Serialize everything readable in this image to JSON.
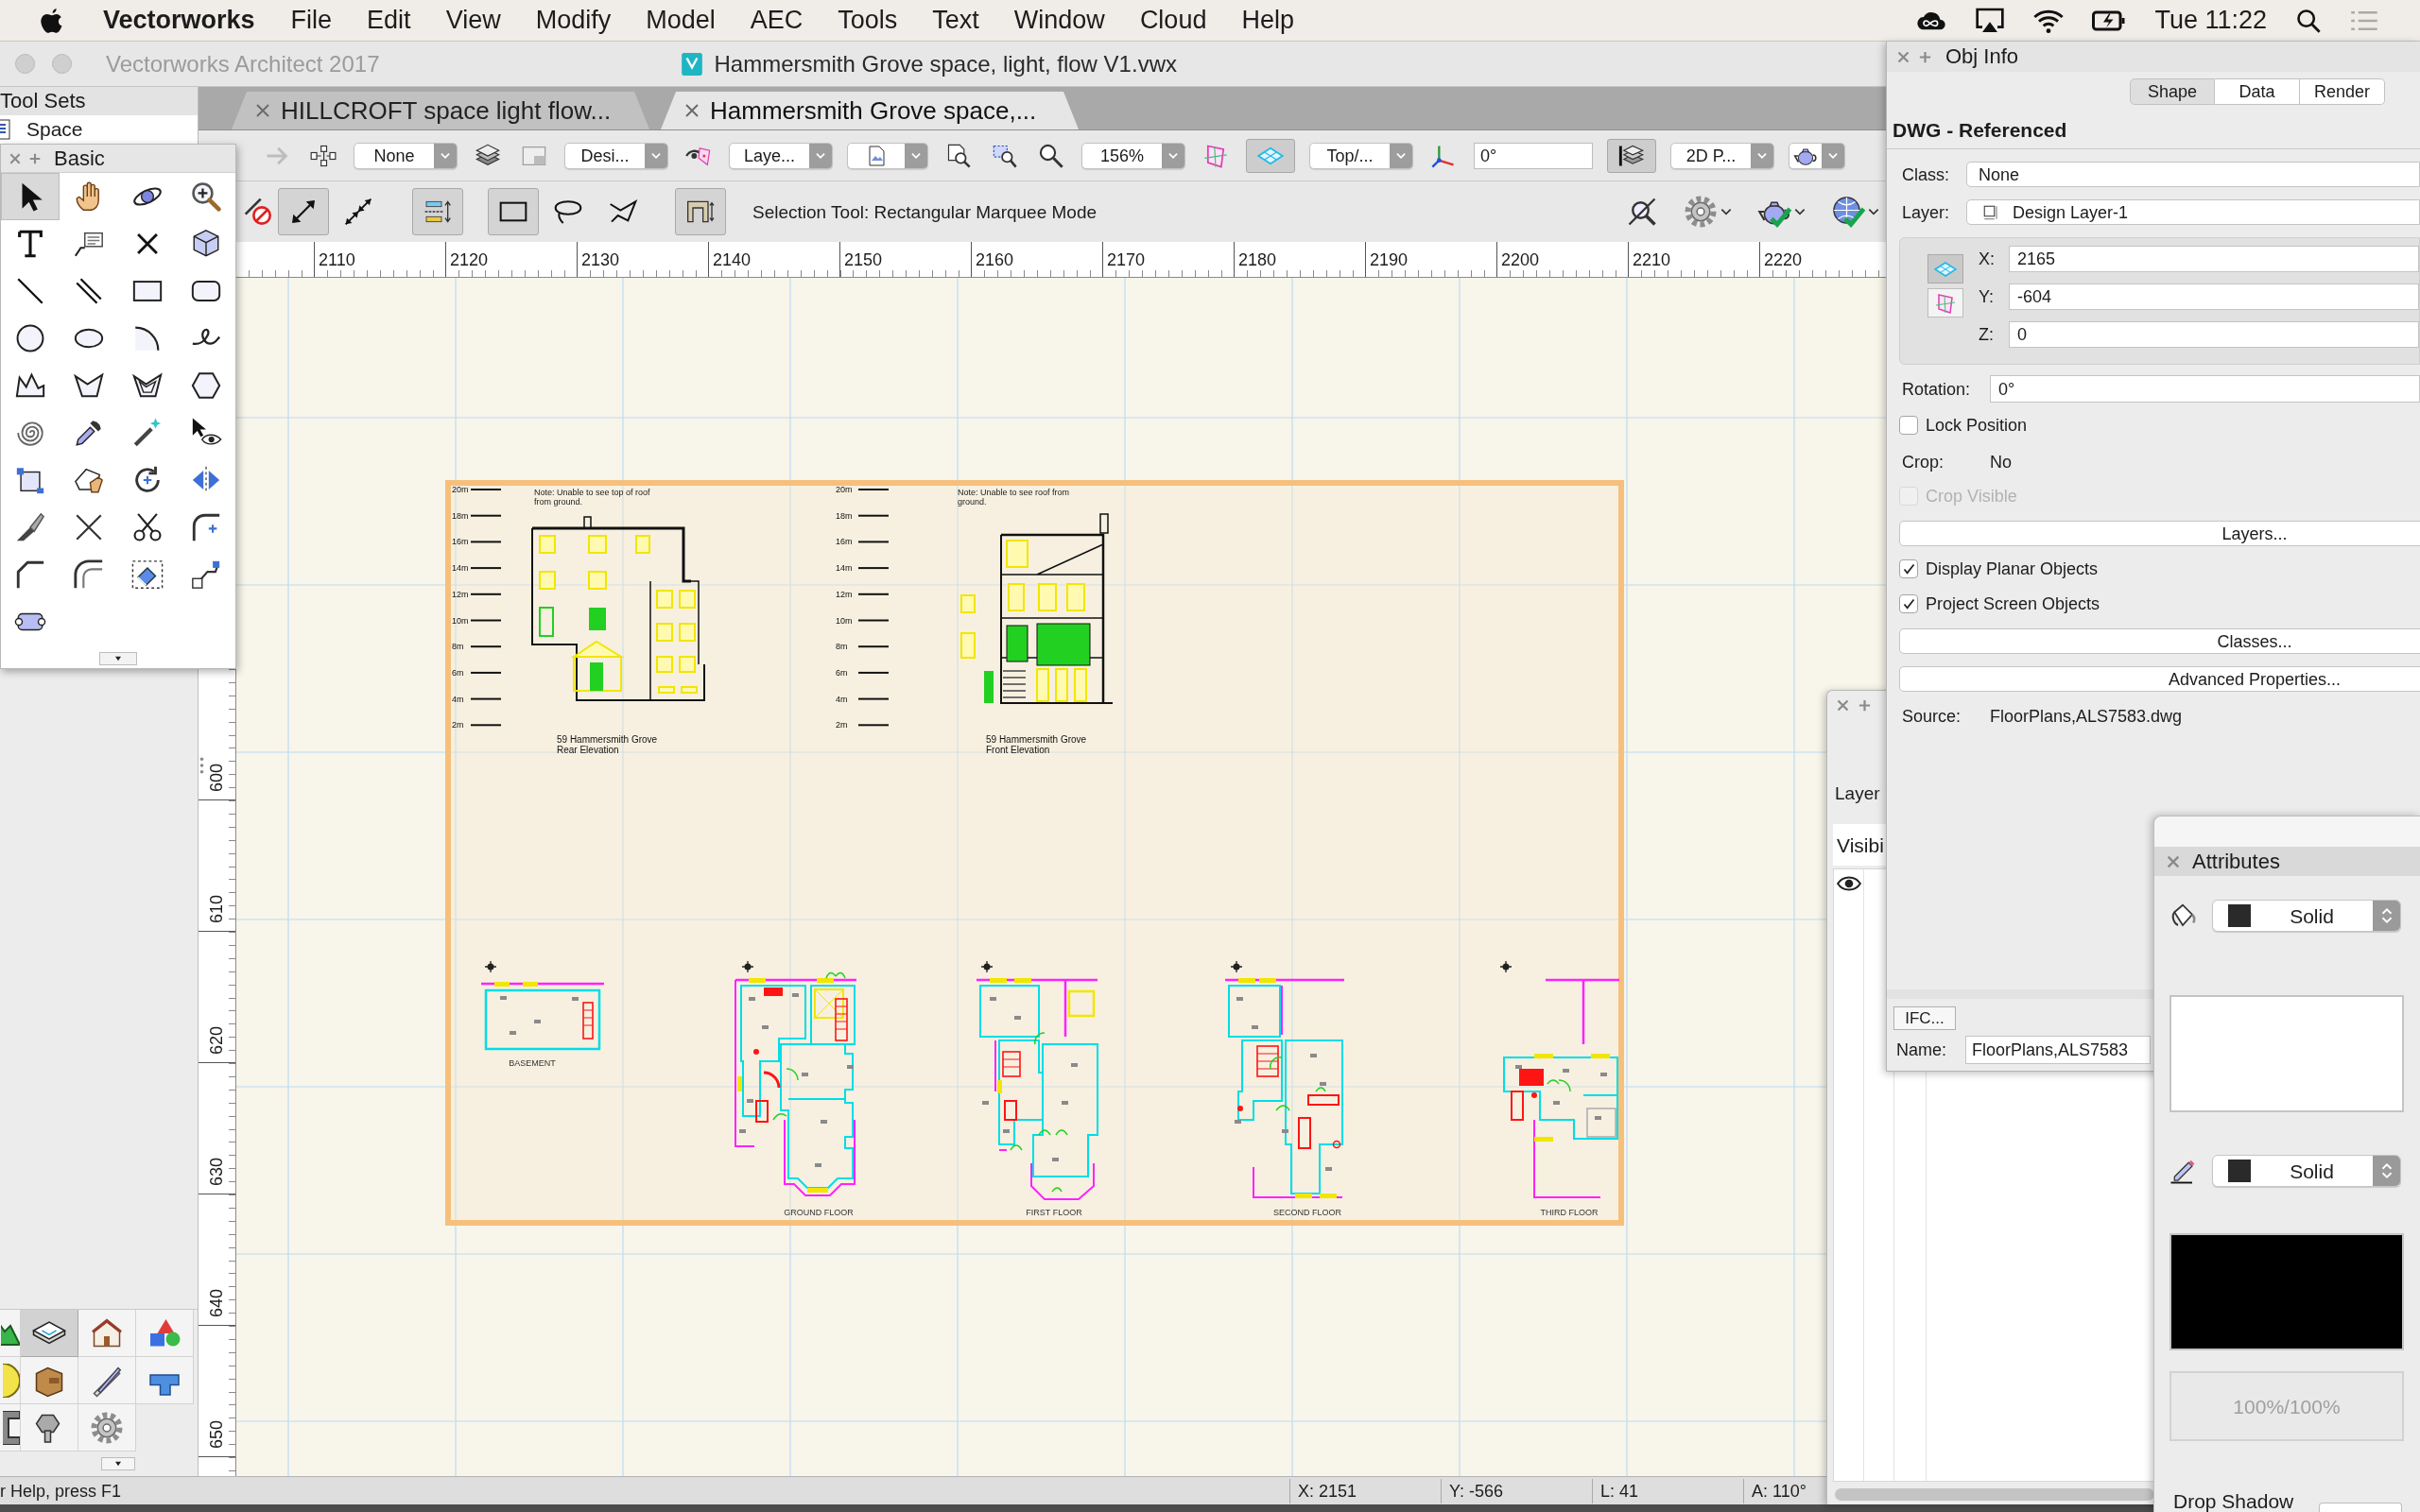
{
  "menu_bar": {
    "app_name": "Vectorworks",
    "menus": [
      "File",
      "Edit",
      "View",
      "Modify",
      "Model",
      "AEC",
      "Tools",
      "Text",
      "Window",
      "Cloud",
      "Help"
    ],
    "clock": "Tue 11:22"
  },
  "window": {
    "app_title": "Vectorworks Architect 2017",
    "document_title": "Hammersmith Grove space, light, flow V1.vwx"
  },
  "tool_sets": {
    "title": "Tool Sets",
    "current": "Space",
    "sets": [
      {
        "kind": "site",
        "selected": false
      },
      {
        "kind": "slab",
        "selected": true
      },
      {
        "kind": "house",
        "selected": false
      },
      {
        "kind": "shapes",
        "selected": false
      },
      {
        "kind": "light",
        "selected": false
      },
      {
        "kind": "cabinet",
        "selected": false
      },
      {
        "kind": "drafting",
        "selected": false
      },
      {
        "kind": "pipe",
        "selected": false
      },
      {
        "kind": "beam",
        "selected": false
      },
      {
        "kind": "bolt",
        "selected": false
      },
      {
        "kind": "gear",
        "selected": false
      }
    ]
  },
  "basic_palette": {
    "title": "Basic",
    "tools": [
      {
        "kind": "selection",
        "selected": true
      },
      {
        "kind": "pan",
        "selected": false
      },
      {
        "kind": "flyover",
        "selected": false
      },
      {
        "kind": "zoom",
        "selected": false
      },
      {
        "kind": "text",
        "selected": false
      },
      {
        "kind": "callout",
        "selected": false
      },
      {
        "kind": "locus",
        "selected": false
      },
      {
        "kind": "pushpull",
        "selected": false
      },
      {
        "kind": "line",
        "selected": false
      },
      {
        "kind": "double_line",
        "selected": false
      },
      {
        "kind": "rectangle",
        "selected": false
      },
      {
        "kind": "rounded_rectangle",
        "selected": false
      },
      {
        "kind": "circle",
        "selected": false
      },
      {
        "kind": "oval",
        "selected": false
      },
      {
        "kind": "arc",
        "selected": false
      },
      {
        "kind": "freehand",
        "selected": false
      },
      {
        "kind": "polyline",
        "selected": false
      },
      {
        "kind": "polygon",
        "selected": false
      },
      {
        "kind": "double_polygon",
        "selected": false
      },
      {
        "kind": "regular_polygon",
        "selected": false
      },
      {
        "kind": "spiral",
        "selected": false
      },
      {
        "kind": "eyedropper",
        "selected": false
      },
      {
        "kind": "wand",
        "selected": false
      },
      {
        "kind": "visibility",
        "selected": false
      },
      {
        "kind": "reshape",
        "selected": false
      },
      {
        "kind": "attribute_mapping",
        "selected": false
      },
      {
        "kind": "rotate",
        "selected": false
      },
      {
        "kind": "mirror",
        "selected": false
      },
      {
        "kind": "split",
        "selected": false
      },
      {
        "kind": "connect",
        "selected": false
      },
      {
        "kind": "trim",
        "selected": false
      },
      {
        "kind": "fillet",
        "selected": false
      },
      {
        "kind": "chamfer",
        "selected": false
      },
      {
        "kind": "offset",
        "selected": false
      },
      {
        "kind": "eraser",
        "selected": false
      },
      {
        "kind": "clip",
        "selected": false
      },
      {
        "kind": "symbol",
        "selected": false
      }
    ]
  },
  "tabs": [
    {
      "label": "HILLCROFT space light flow...",
      "selected": false
    },
    {
      "label": "Hammersmith Grove space,...",
      "selected": true
    }
  ],
  "view_bar": [
    {
      "kind": "forward",
      "selected": false
    },
    {
      "kind": "classes",
      "selected": false
    },
    {
      "kind": "dropdown",
      "value": "None"
    },
    {
      "kind": "layers",
      "selected": false
    },
    {
      "kind": "layer_mode",
      "selected": false
    },
    {
      "kind": "dropdown",
      "value": "Desi..."
    },
    {
      "kind": "class_visibility",
      "selected": false
    },
    {
      "kind": "dropdown",
      "value": "Laye..."
    },
    {
      "kind": "page_menu"
    },
    {
      "kind": "fit_page",
      "selected": false
    },
    {
      "kind": "fit_objects",
      "selected": false
    },
    {
      "kind": "magnifier",
      "selected": false
    },
    {
      "kind": "dropdown",
      "value": "156%"
    },
    {
      "kind": "working_plane",
      "selected": false
    },
    {
      "kind": "screen_plane",
      "selected": true
    },
    {
      "kind": "dropdown",
      "value": "Top/..."
    },
    {
      "kind": "axes",
      "selected": false
    },
    {
      "kind": "field",
      "value": "0°"
    },
    {
      "kind": "stack_layers",
      "selected": true
    },
    {
      "kind": "dropdown",
      "value": "2D P..."
    },
    {
      "kind": "render_menu"
    }
  ],
  "mode_bar": {
    "modes": [
      {
        "kind": "snap_off",
        "selected": false
      },
      {
        "kind": "snap_single",
        "selected": true
      },
      {
        "kind": "snap_multi",
        "selected": false
      },
      {
        "kind": "align",
        "selected": true
      },
      {
        "kind": "marquee_rect",
        "selected": true
      },
      {
        "kind": "marquee_lasso",
        "selected": false
      },
      {
        "kind": "marquee_polygon",
        "selected": false
      },
      {
        "kind": "frame",
        "selected": true
      }
    ],
    "message": "Selection Tool: Rectangular Marquee Mode",
    "tools": [
      {
        "kind": "no_zoom"
      },
      {
        "kind": "gear_menu"
      },
      {
        "kind": "render_check_menu"
      },
      {
        "kind": "globe_check_menu"
      }
    ]
  },
  "rulers": {
    "horizontal": [
      "2110",
      "2120",
      "2130",
      "2140",
      "2150",
      "2160",
      "2170",
      "2180",
      "2190",
      "2200",
      "2210",
      "2220"
    ],
    "vertical": [
      "600",
      "610",
      "620",
      "630",
      "640",
      "650"
    ]
  },
  "drawing": {
    "elevations": [
      {
        "kind": "rear",
        "note": [
          "Note: Unable to see top of roof",
          "from ground."
        ],
        "scale": [
          "20m",
          "18m",
          "16m",
          "14m",
          "12m",
          "10m",
          "8m",
          "6m",
          "4m",
          "2m"
        ],
        "title": "59 Hammersmith Grove",
        "caption": "Rear Elevation"
      },
      {
        "kind": "front",
        "note": [
          "Note: Unable to see roof from",
          "ground."
        ],
        "scale": [
          "20m",
          "18m",
          "16m",
          "14m",
          "12m",
          "10m",
          "8m",
          "6m",
          "4m",
          "2m"
        ],
        "title": "59 Hammersmith Grove",
        "caption": "Front Elevation"
      }
    ],
    "floor_plans": [
      {
        "kind": "basement",
        "label": "BASEMENT"
      },
      {
        "kind": "ground",
        "label": "GROUND FLOOR"
      },
      {
        "kind": "first",
        "label": "FIRST FLOOR"
      },
      {
        "kind": "second",
        "label": "SECOND FLOOR"
      },
      {
        "kind": "third",
        "label": "THIRD FLOOR"
      }
    ]
  },
  "obj_info": {
    "title": "Obj Info",
    "tabs": [
      {
        "label": "Shape",
        "selected": true
      },
      {
        "label": "Data",
        "selected": false
      },
      {
        "label": "Render",
        "selected": false
      }
    ],
    "object_type": "DWG - Referenced",
    "class": {
      "label": "Class:",
      "value": "None"
    },
    "layer": {
      "label": "Layer:",
      "value": "Design Layer-1"
    },
    "planes": [
      {
        "kind": "screen",
        "selected": true
      },
      {
        "kind": "layer",
        "selected": false
      }
    ],
    "coordinates": [
      {
        "label": "X:",
        "value": "2165"
      },
      {
        "label": "Y:",
        "value": "-604"
      },
      {
        "label": "Z:",
        "value": "0"
      }
    ],
    "rotation": {
      "label": "Rotation:",
      "value": "0°"
    },
    "rows": [
      {
        "kind": "checkbox",
        "label": "Lock Position",
        "checked": false,
        "disabled": false
      },
      {
        "kind": "value",
        "label": "Crop:",
        "value": "No"
      },
      {
        "kind": "checkbox",
        "label": "Crop Visible",
        "checked": false,
        "disabled": true
      },
      {
        "kind": "button",
        "label": "Layers..."
      },
      {
        "kind": "checkbox",
        "label": "Display Planar Objects",
        "checked": true,
        "disabled": false
      },
      {
        "kind": "checkbox",
        "label": "Project Screen Objects",
        "checked": true,
        "disabled": false
      },
      {
        "kind": "button",
        "label": "Classes..."
      },
      {
        "kind": "button",
        "label": "Advanced Properties..."
      },
      {
        "kind": "value",
        "label": "Source:",
        "value": "FloorPlans,ALS7583.dwg"
      }
    ],
    "ifc_button": "IFC...",
    "name": {
      "label": "Name:",
      "value": "FloorPlans,ALS7583"
    }
  },
  "layer_panel": {
    "title": "Layer",
    "column": "Visibi"
  },
  "attributes": {
    "title": "Attributes",
    "rows": [
      {
        "kind": "fill",
        "style": "Solid"
      },
      {
        "kind": "pen",
        "style": "Solid"
      }
    ],
    "opacity": "100%/100%",
    "drop_shadow": "Drop Shadow"
  },
  "status_bar": {
    "help": "r Help, press F1",
    "fields": [
      "X: 2151",
      "Y: -566",
      "L: 41",
      "A: 110°"
    ]
  }
}
